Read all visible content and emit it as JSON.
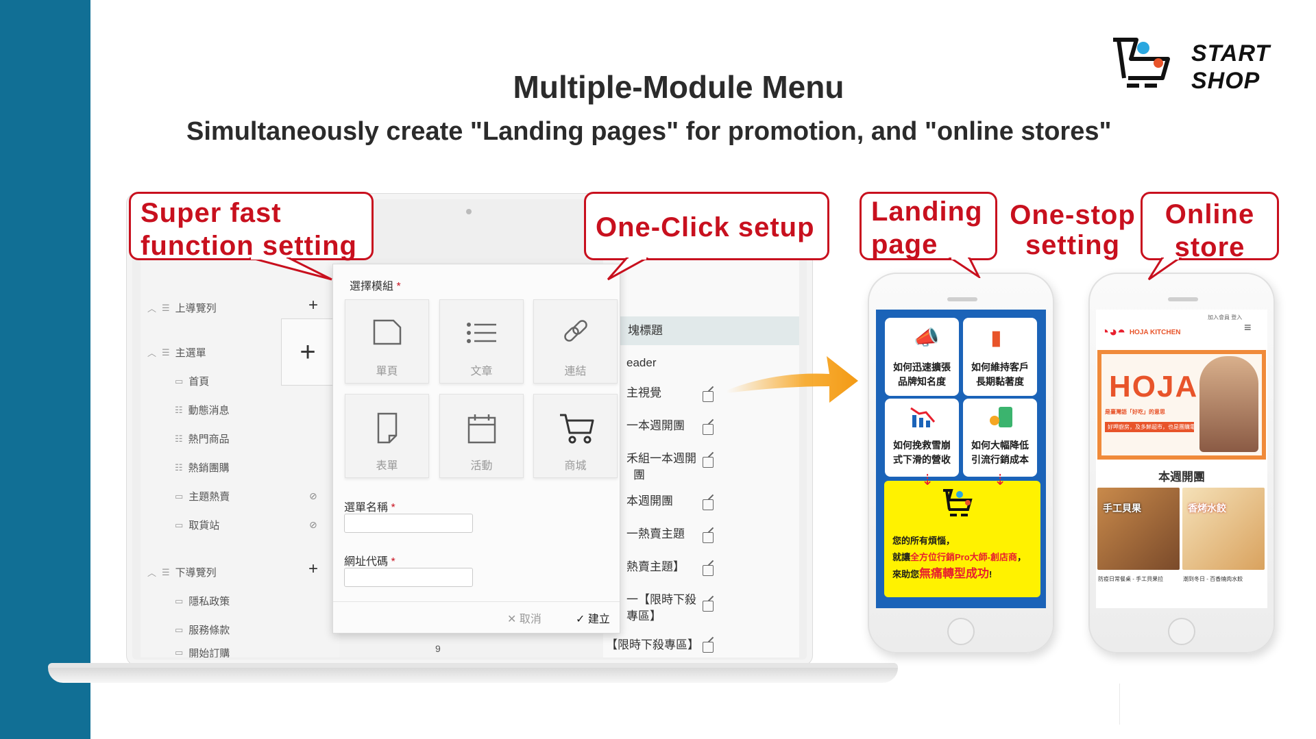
{
  "title": "Multiple-Module Menu",
  "subtitle": "Simultaneously create \"Landing pages\" for promotion, and  \"online stores\"",
  "logo": {
    "line1": "START",
    "line2": "SHOP"
  },
  "callouts": {
    "function_setting": {
      "line1": "Super fast",
      "line2": "function setting"
    },
    "one_click": "One-Click setup",
    "landing_page": {
      "line1": "Landing",
      "line2": "page"
    },
    "one_stop": {
      "line1": "One-stop",
      "line2": "setting"
    },
    "online_store": {
      "line1": "Online",
      "line2": "store"
    }
  },
  "colors": {
    "accent": "#c8101e",
    "band": "#116f95",
    "landing_bg": "#1b63b8",
    "highlight": "#fff200",
    "brand_orange": "#e8542a"
  },
  "sidebar": {
    "top_nav": "上導覽列",
    "main_menu": "主選單",
    "main_items": [
      "首頁",
      "動態消息",
      "熱門商品",
      "熱銷團購",
      "主題熱賣",
      "取貨站"
    ],
    "bottom_nav": "下導覽列",
    "bottom_items": [
      "隱私政策",
      "服務條款",
      "開始訂購"
    ]
  },
  "list": {
    "rows": [
      "塊標題",
      "eader",
      "主視覺",
      "一本週開團",
      "禾組一本週開",
      "團",
      "本週開團",
      "一熱賣主題",
      "熱賣主題】",
      "一【限時下殺",
      "專區】",
      "【限時下殺專區】"
    ],
    "page_number": "9"
  },
  "dialog": {
    "module_label": "選擇模組",
    "required_mark": "*",
    "modules": [
      "單頁",
      "文章",
      "連結",
      "表單",
      "活動",
      "商城"
    ],
    "menu_name_label": "選單名稱",
    "url_code_label": "網址代碼",
    "cancel": "取消",
    "create": "建立"
  },
  "landing": {
    "tiles": [
      {
        "l1": "如何迅速擴張",
        "l2": "品牌知名度"
      },
      {
        "l1": "如何維持客戶",
        "l2": "長期黏著度"
      },
      {
        "l1": "如何挽救雪崩",
        "l2": "式下滑的營收"
      },
      {
        "l1": "如何大幅降低",
        "l2": "引流行銷成本"
      }
    ],
    "line1": "您的所有煩惱，",
    "line2_pre": "就讓",
    "line2_em": "全方位行銷Pro大師-創店商",
    "line2_post": "，",
    "line3_pre": "來助您",
    "line3_em": "無痛轉型成功",
    "line3_post": "!"
  },
  "store": {
    "brand": "HOJA",
    "brand_sub": "KITCHEN",
    "top_links": [
      "加入會員",
      "登入"
    ],
    "banner_title": "HOJA",
    "banner_sub": "是臺灣語「好吃」的意思",
    "banner_cta": "好呷廚房，及多鮮超市，也是團購電商",
    "heading": "本週開團",
    "card1_caption": "防疫日常餐桌 - 手工貝果拉",
    "card2_caption": "潮到冬日 - 百香燒肉水餃",
    "card1_title": "手工貝果",
    "card2_title": "香烤水餃"
  }
}
